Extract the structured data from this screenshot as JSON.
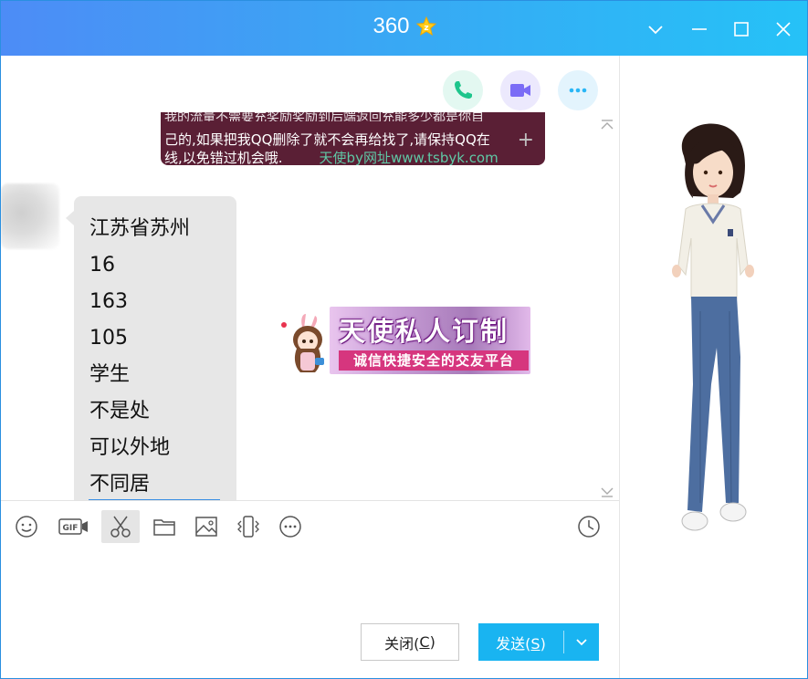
{
  "window": {
    "title": "360",
    "controls": [
      "chevron-down-icon",
      "minimize-icon",
      "maximize-icon",
      "close-icon"
    ]
  },
  "header_actions": [
    {
      "name": "voice-call",
      "icon": "phone-icon",
      "color": "#1ec58c"
    },
    {
      "name": "video-call",
      "icon": "video-camera-icon",
      "color": "#7b6cf6"
    },
    {
      "name": "more",
      "icon": "more-icon",
      "color": "#29b6f6"
    }
  ],
  "notice": {
    "line1": "我的流量不需要充奖励奖励到后端返回充能多少都是你自",
    "line2": "己的,如果把我QQ删除了就不会再给找了,请保持QQ在",
    "line3": "线,以免错过机会哦.",
    "watermark": "天使by网址www.tsbyk.com"
  },
  "message": {
    "lines": [
      "江苏省苏州",
      "16",
      "163",
      "105",
      "学生",
      "不是处",
      "可以外地",
      "不同居"
    ]
  },
  "ad": {
    "title": "天使私人订制",
    "subtitle": "诚信快捷安全的交友平台"
  },
  "toolbar": {
    "items": [
      "emoji-icon",
      "gif-icon",
      "scissors-icon",
      "folder-icon",
      "image-icon",
      "shake-icon",
      "more-icon",
      "clock-icon"
    ]
  },
  "buttons": {
    "close_label": "关闭(",
    "close_key": "C",
    "close_tail": ")",
    "send_label": "发送(",
    "send_key": "S",
    "send_tail": ")"
  },
  "colors": {
    "title_gradient_start": "#4d8cf6",
    "title_gradient_end": "#25c2f7",
    "send_button": "#19b4f1",
    "notice_bg": "#5a1f35"
  }
}
